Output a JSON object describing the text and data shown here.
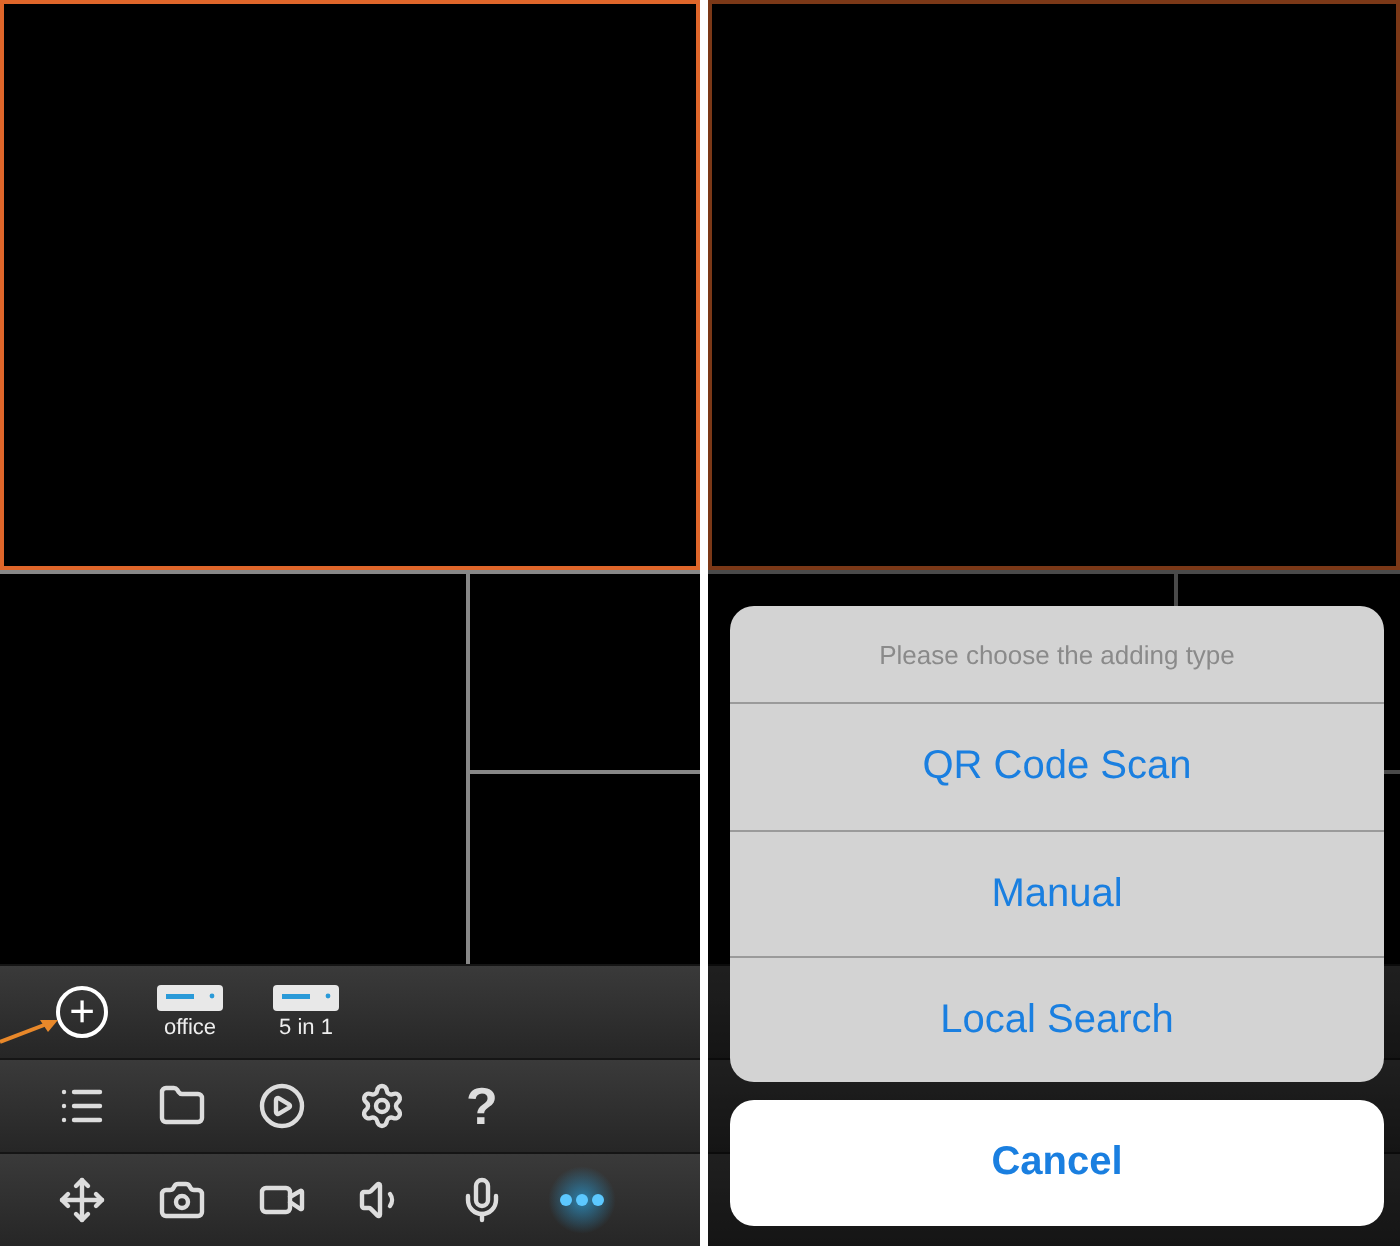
{
  "left_screen": {
    "cells": [
      {
        "selected": true
      },
      {
        "selected": false
      },
      {
        "selected": false
      },
      {
        "selected": false
      }
    ],
    "add_button": {
      "glyph": "+"
    },
    "devices": [
      {
        "label": "office"
      },
      {
        "label": "5 in 1"
      }
    ],
    "menu_bar": [
      {
        "kind": "list"
      },
      {
        "kind": "folder"
      },
      {
        "kind": "playback"
      },
      {
        "kind": "settings"
      },
      {
        "kind": "help",
        "glyph": "?"
      }
    ],
    "control_bar": [
      {
        "kind": "move",
        "selected": false
      },
      {
        "kind": "camera",
        "selected": false
      },
      {
        "kind": "video",
        "selected": false
      },
      {
        "kind": "speaker",
        "selected": false
      },
      {
        "kind": "mic",
        "selected": false
      },
      {
        "kind": "more",
        "selected": true
      }
    ]
  },
  "right_screen": {
    "cells": [
      {
        "selected": true
      },
      {
        "selected": false
      },
      {
        "selected": false
      },
      {
        "selected": false
      }
    ],
    "action_sheet": {
      "title": "Please choose the adding type",
      "options": [
        "QR Code Scan",
        "Manual",
        "Local Search"
      ],
      "cancel": "Cancel"
    }
  }
}
